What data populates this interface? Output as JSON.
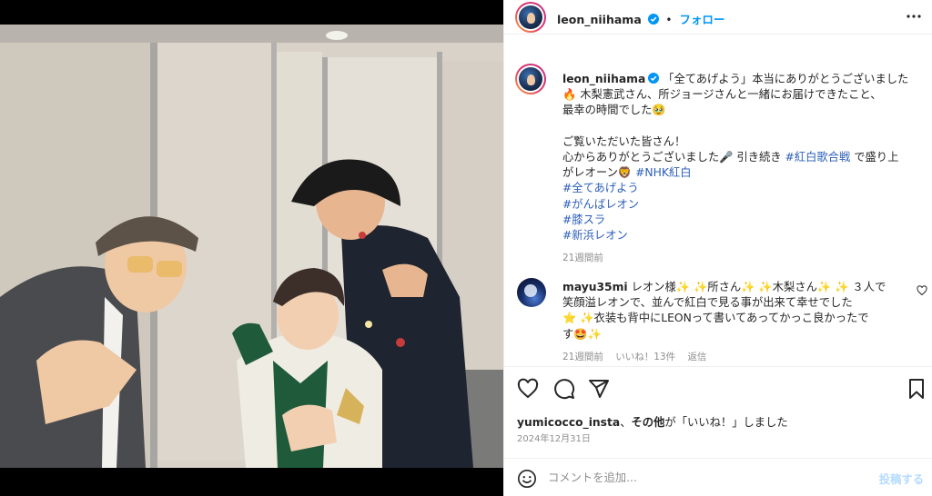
{
  "header": {
    "username": "leon_niihama",
    "separator": "•",
    "follow_label": "フォロー"
  },
  "caption": {
    "username": "leon_niihama",
    "line1": "「全てあげよう」本当にありがとうございました",
    "line2": "🔥 木梨憲武さん、所ジョージさんと一緒にお届けできたこと、",
    "line3": "最幸の時間でした🥹",
    "line4": "ご覧いただいた皆さん！",
    "line5a": "心からありがとうございました🎤 引き続き ",
    "hashtag_kouhaku_kassen": "#紅白歌合戦",
    "line5b": " で盛り上",
    "line6a": "がレオーン🦁 ",
    "hashtag_nhk": "#NHK紅白",
    "hashtags": [
      "#全てあげよう",
      "#がんばレオン",
      "#膝スラ",
      "#新浜レオン"
    ],
    "time": "21週間前"
  },
  "comment": {
    "username": "mayu35mi",
    "text_line1": "レオン様✨ ✨所さん✨ ✨木梨さん✨ ✨ ３人で",
    "text_line2": "笑顔溢レオンで、並んで紅白で見る事が出来て幸せでした",
    "text_line3": "⭐️ ✨衣装も背中にLEONって書いてあってかっこ良かったで",
    "text_line4": "す🤩✨",
    "time": "21週間前",
    "likes": "いいね！13件",
    "reply": "返信"
  },
  "likes": {
    "user": "yumicocco_insta",
    "sep": "、",
    "others": "その他",
    "suffix": "が「いいね！」しました"
  },
  "date": "2024年12月31日",
  "composer": {
    "placeholder": "コメントを追加...",
    "post_label": "投稿する"
  },
  "icons": {
    "like": "heart-icon",
    "comment": "comment-icon",
    "share": "share-icon",
    "save": "bookmark-icon",
    "more": "more-icon",
    "emoji": "emoji-icon"
  },
  "colors": {
    "link_blue": "#0095f6",
    "hashtag": "#2d5fb8",
    "muted": "#8e8e8e"
  }
}
